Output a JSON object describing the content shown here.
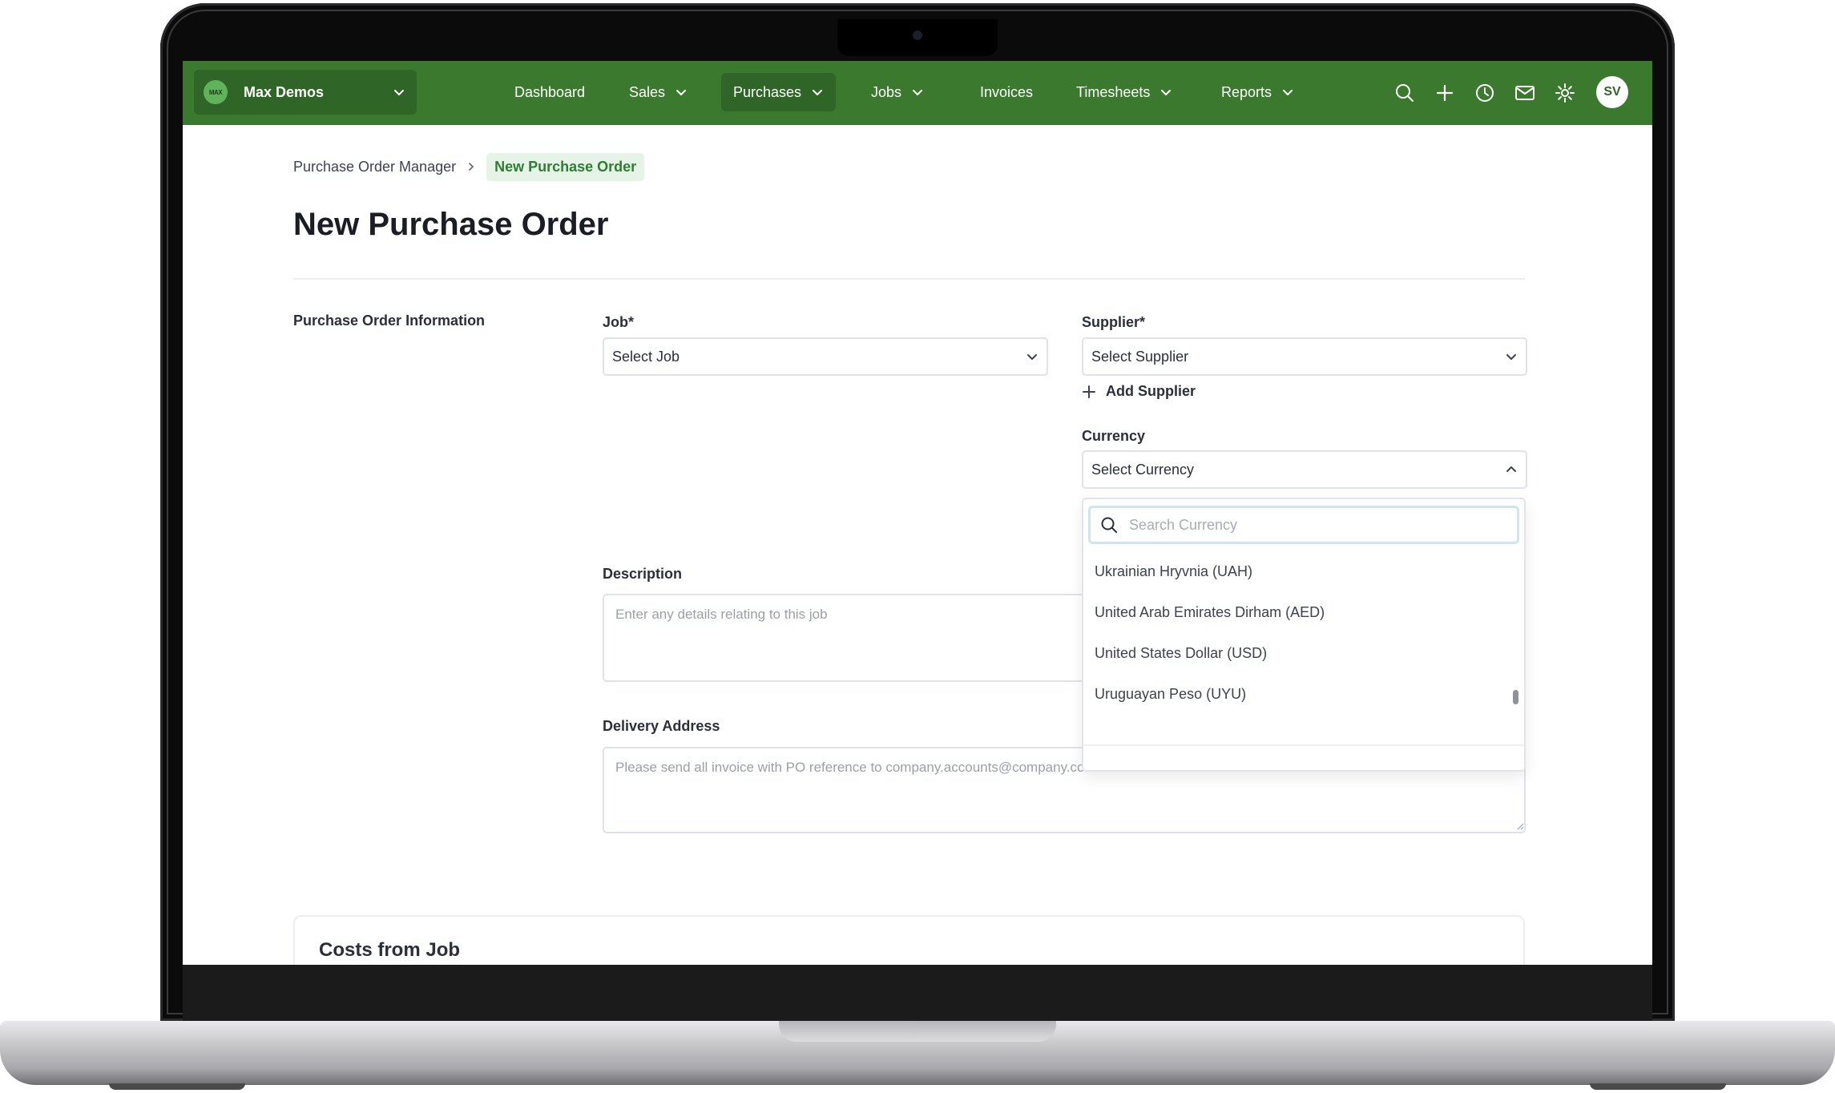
{
  "topbar": {
    "bg_color": "#3b7a2e",
    "org": {
      "logo_text": "MAX",
      "name": "Max Demos",
      "icon": "chevron-down-icon"
    },
    "nav": [
      {
        "label": "Dashboard",
        "has_caret": false,
        "active": false
      },
      {
        "label": "Sales",
        "has_caret": true,
        "active": false
      },
      {
        "label": "Purchases",
        "has_caret": true,
        "active": true
      },
      {
        "label": "Jobs",
        "has_caret": true,
        "active": false
      },
      {
        "label": "Invoices",
        "has_caret": false,
        "active": false
      },
      {
        "label": "Timesheets",
        "has_caret": true,
        "active": false
      },
      {
        "label": "Reports",
        "has_caret": true,
        "active": false
      }
    ],
    "icons": [
      "search-icon",
      "plus-icon",
      "clock-icon",
      "mail-icon",
      "gear-icon"
    ],
    "avatar_initials": "SV"
  },
  "breadcrumb": {
    "parent": "Purchase Order Manager",
    "current": "New Purchase Order"
  },
  "page_title": "New Purchase Order",
  "form": {
    "section_label": "Purchase Order Information",
    "job": {
      "label": "Job*",
      "value": "Select Job"
    },
    "supplier": {
      "label": "Supplier*",
      "value": "Select Supplier",
      "add_label": "Add Supplier"
    },
    "currency": {
      "label": "Currency",
      "value": "Select Currency",
      "search_placeholder": "Search Currency",
      "options": [
        "Ukrainian Hryvnia (UAH)",
        "United Arab Emirates Dirham (AED)",
        "United States Dollar (USD)",
        "Uruguayan Peso (UYU)"
      ]
    },
    "description": {
      "label": "Description",
      "placeholder": "Enter any details relating to this job"
    },
    "delivery": {
      "label": "Delivery Address",
      "placeholder": "Please send all invoice with PO reference to company.accounts@company.com"
    }
  },
  "costs_card": {
    "title": "Costs from Job"
  },
  "colors": {
    "accent_green": "#2e7d32",
    "nav_active": "#2f6526"
  }
}
